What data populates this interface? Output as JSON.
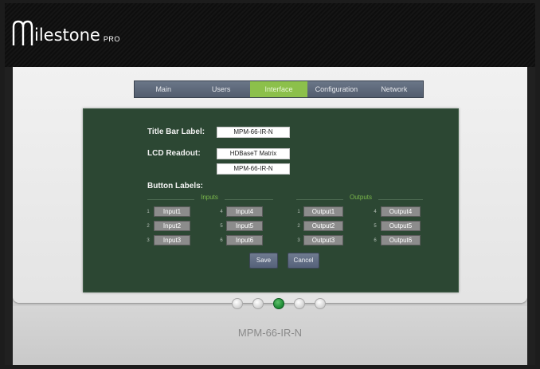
{
  "brand": {
    "logo_word": "ilestone",
    "logo_suffix": "PRO"
  },
  "nav": {
    "tabs": [
      {
        "label": "Main",
        "active": false
      },
      {
        "label": "Users",
        "active": false
      },
      {
        "label": "Interface",
        "active": true
      },
      {
        "label": "Configuration",
        "active": false
      },
      {
        "label": "Network",
        "active": false
      }
    ]
  },
  "form": {
    "title_bar_label": "Title Bar Label:",
    "title_bar_value": "MPM-66-IR-N",
    "lcd_readout_label": "LCD Readout:",
    "lcd_line1": "HDBaseT Matrix",
    "lcd_line2": "MPM-66-IR-N",
    "button_labels_label": "Button Labels:",
    "inputs_title": "Inputs",
    "outputs_title": "Outputs",
    "inputs": [
      {
        "num": "1",
        "value": "Input1"
      },
      {
        "num": "2",
        "value": "Input2"
      },
      {
        "num": "3",
        "value": "Input3"
      },
      {
        "num": "4",
        "value": "Input4"
      },
      {
        "num": "5",
        "value": "Input5"
      },
      {
        "num": "6",
        "value": "Input6"
      }
    ],
    "outputs": [
      {
        "num": "1",
        "value": "Output1"
      },
      {
        "num": "2",
        "value": "Output2"
      },
      {
        "num": "3",
        "value": "Output3"
      },
      {
        "num": "4",
        "value": "Output4"
      },
      {
        "num": "5",
        "value": "Output5"
      },
      {
        "num": "6",
        "value": "Output6"
      }
    ],
    "save_label": "Save",
    "cancel_label": "Cancel"
  },
  "pager": {
    "count": 5,
    "active_index": 2
  },
  "device_name": "MPM-66-IR-N",
  "colors": {
    "accent_green": "#8cc04b",
    "panel_green": "#2c4733",
    "tab_blue": "#5a6678",
    "pager_active": "#1f8c36"
  }
}
